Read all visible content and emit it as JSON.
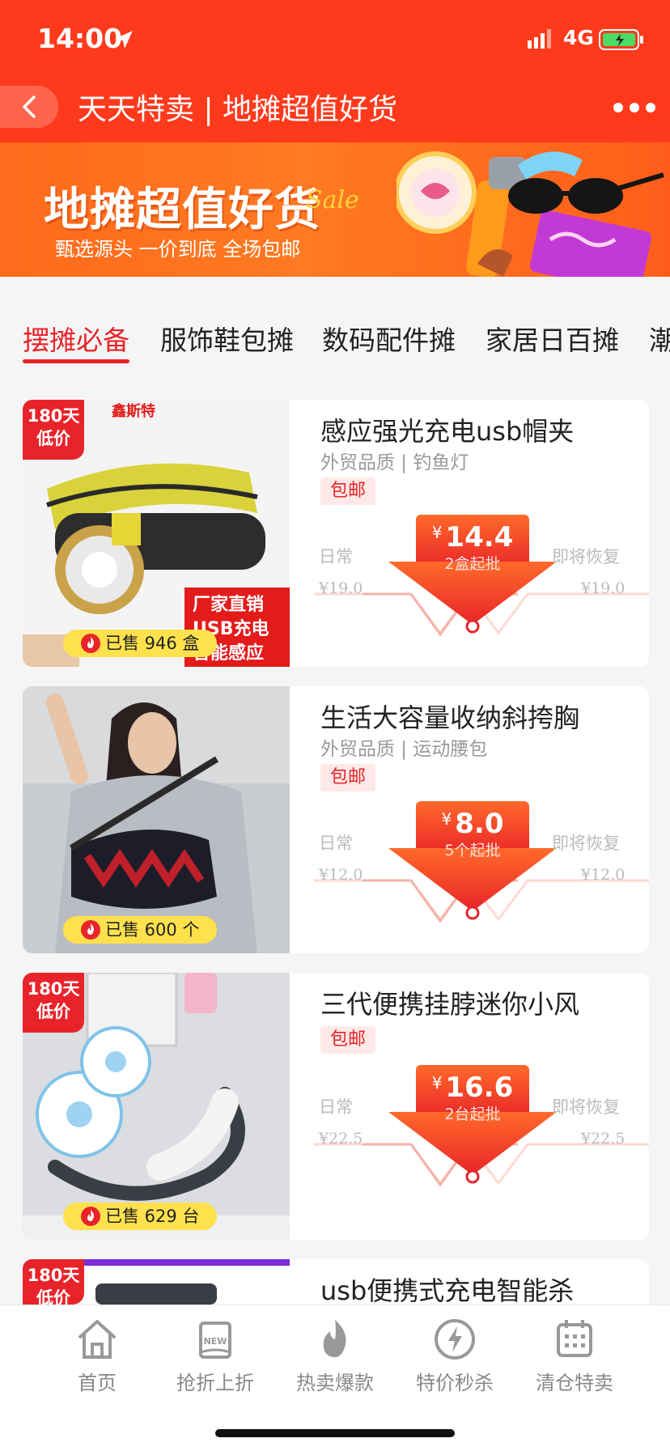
{
  "status_bar": {
    "time": "14:00",
    "network": "4G"
  },
  "nav": {
    "title": "天天特卖 | 地摊超值好货"
  },
  "banner": {
    "title": "地摊超值好货",
    "sale": "Sale",
    "subtitle": "甄选源头 一价到底 全场包邮"
  },
  "tabs": [
    {
      "label": "摆摊必备",
      "active": true
    },
    {
      "label": "服饰鞋包摊",
      "active": false
    },
    {
      "label": "数码配件摊",
      "active": false
    },
    {
      "label": "家居日百摊",
      "active": false
    },
    {
      "label": "潮",
      "active": false
    }
  ],
  "badge": {
    "line1": "180天",
    "line2": "低价"
  },
  "labels": {
    "usual": "日常",
    "restore": "即将恢复",
    "currency": "¥"
  },
  "products": [
    {
      "title": "感应强光充电usb帽夹",
      "subtitle": "外贸品质 | 钓鱼灯",
      "tag": "包邮",
      "price": "14.4",
      "min_qty": "2盒起批",
      "usual_price": "¥19.0",
      "restore_price": "¥19.0",
      "sold": "已售 946 盒",
      "has_badge": true,
      "image_text": {
        "brand": "鑫斯特",
        "lines": [
          "厂家直销",
          "USB充电",
          "智能感应"
        ]
      }
    },
    {
      "title": "生活大容量收纳斜挎胸",
      "subtitle": "外贸品质 | 运动腰包",
      "tag": "包邮",
      "price": "8.0",
      "min_qty": "5个起批",
      "usual_price": "¥12.0",
      "restore_price": "¥12.0",
      "sold": "已售 600 个",
      "has_badge": false
    },
    {
      "title": "三代便携挂脖迷你小风",
      "subtitle": "",
      "tag": "包邮",
      "price": "16.6",
      "min_qty": "2台起批",
      "usual_price": "¥22.5",
      "restore_price": "¥22.5",
      "sold": "已售 629 台",
      "has_badge": true
    },
    {
      "title": "usb便携式充电智能杀",
      "has_badge": true
    }
  ],
  "tabbar": [
    {
      "label": "首页",
      "icon": "home-icon"
    },
    {
      "label": "抢折上折",
      "icon": "new-badge-icon"
    },
    {
      "label": "热卖爆款",
      "icon": "flame-icon"
    },
    {
      "label": "特价秒杀",
      "icon": "lightning-icon"
    },
    {
      "label": "清仓特卖",
      "icon": "calendar-icon"
    }
  ],
  "colors": {
    "brand_red": "#ff3a1c",
    "accent_red": "#e8242a",
    "pill_yellow": "#ffe14d"
  }
}
